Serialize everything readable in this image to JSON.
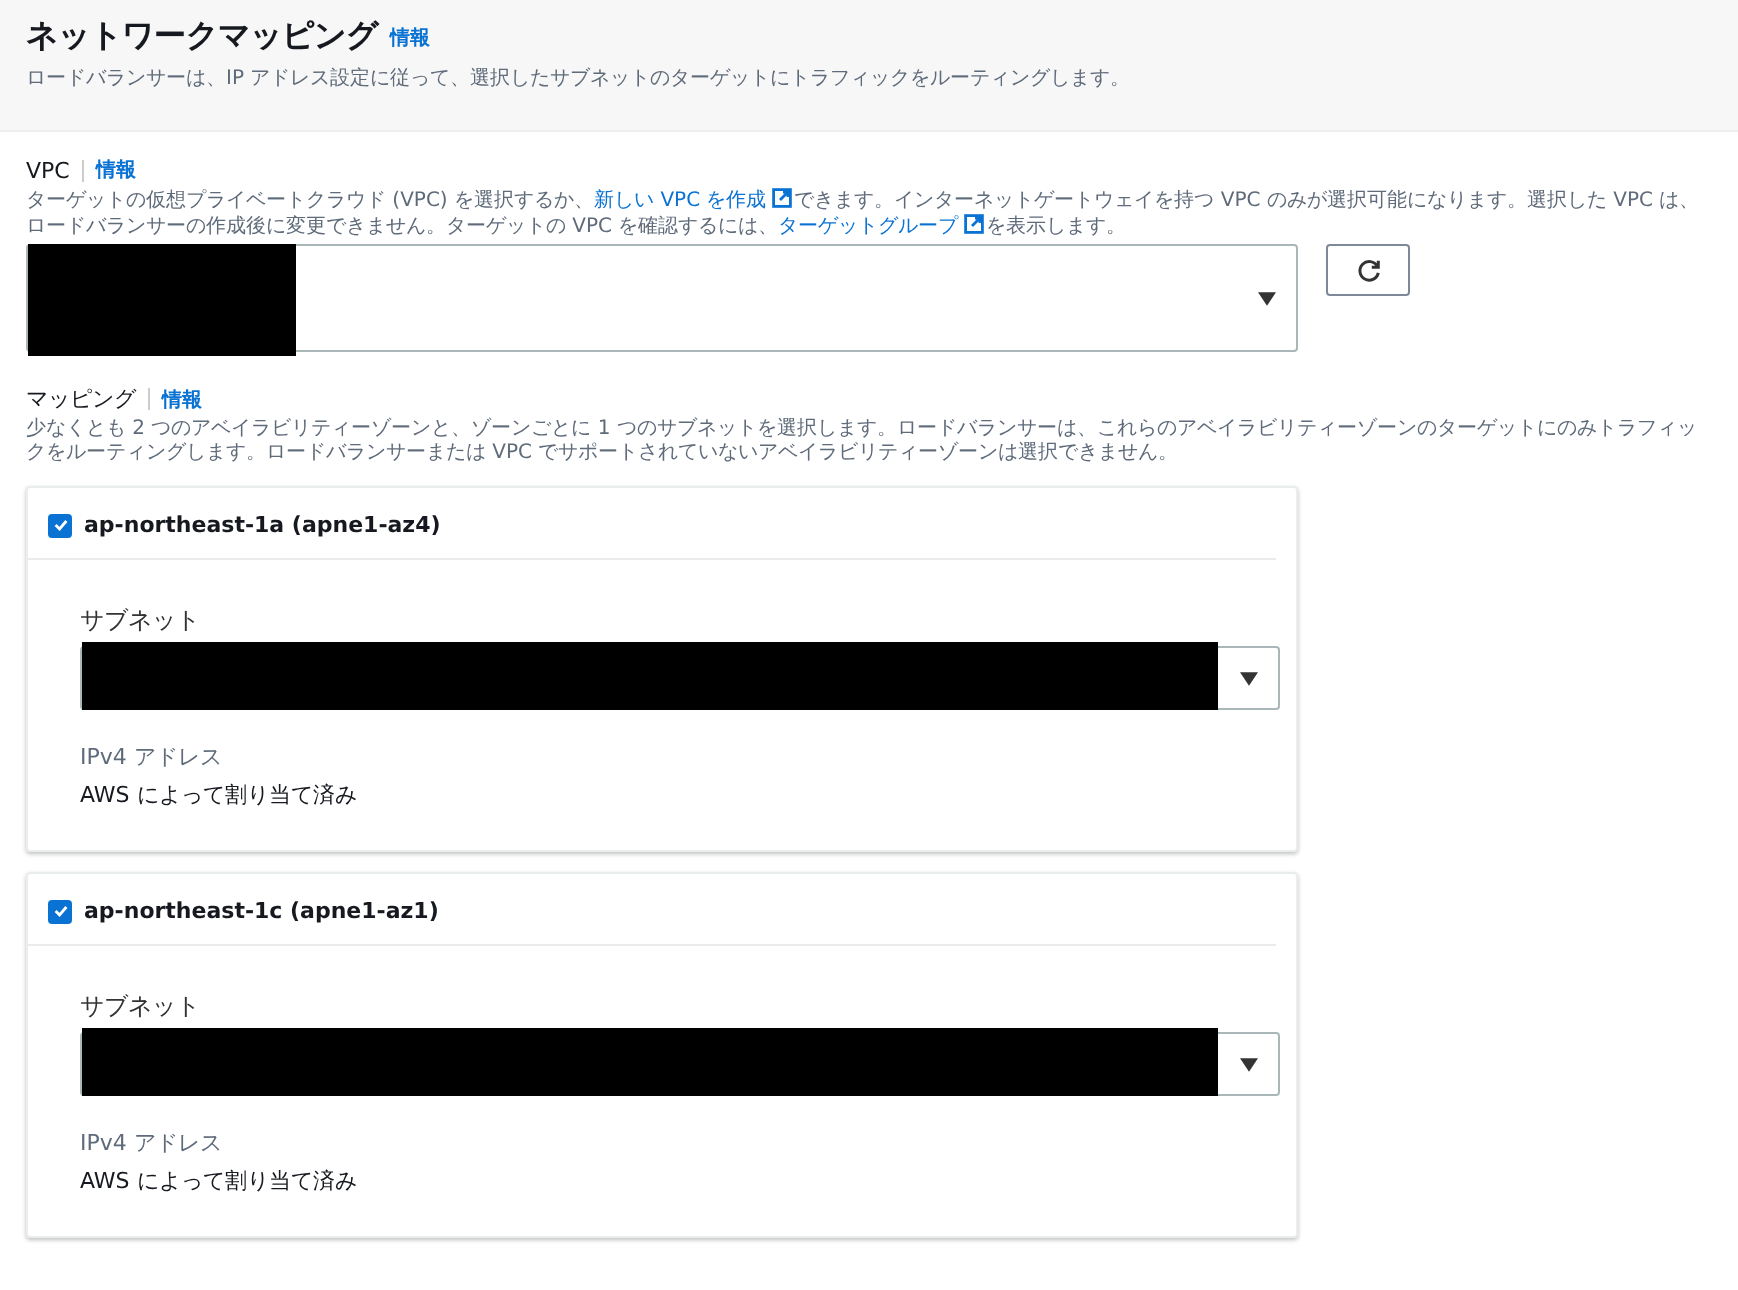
{
  "header": {
    "title": "ネットワークマッピング",
    "info_link": "情報",
    "description": "ロードバランサーは、IP アドレス設定に従って、選択したサブネットのターゲットにトラフィックをルーティングします。"
  },
  "vpc": {
    "label": "VPC",
    "info_link": "情報",
    "description_parts": [
      {
        "kind": "text",
        "text": "ターゲットの仮想プライベートクラウド (VPC) を選択するか、"
      },
      {
        "kind": "link",
        "text": "新しい VPC を作成"
      },
      {
        "kind": "text",
        "text": "できます。インターネットゲートウェイを持つ VPC のみが選択可能になります。選択した VPC は、ロードバランサーの作成後に変更できません。ターゲットの VPC を確認するには、"
      },
      {
        "kind": "link",
        "text": "ターゲットグループ"
      },
      {
        "kind": "text",
        "text": "を表示します。"
      }
    ]
  },
  "mapping": {
    "label": "マッピング",
    "info_link": "情報",
    "description": "少なくとも 2 つのアベイラビリティーゾーンと、ゾーンごとに 1 つのサブネットを選択します。ロードバランサーは、これらのアベイラビリティーゾーンのターゲットにのみトラフィックをルーティングします。ロードバランサーまたは VPC でサポートされていないアベイラビリティーゾーンは選択できません。",
    "zones": [
      {
        "name": "ap-northeast-1a (apne1-az4)",
        "checked": true,
        "subnet_label": "サブネット",
        "ipv4_label": "IPv4 アドレス",
        "ipv4_value": "AWS によって割り当て済み"
      },
      {
        "name": "ap-northeast-1c (apne1-az1)",
        "checked": true,
        "subnet_label": "サブネット",
        "ipv4_label": "IPv4 アドレス",
        "ipv4_value": "AWS によって割り当て済み"
      }
    ]
  }
}
